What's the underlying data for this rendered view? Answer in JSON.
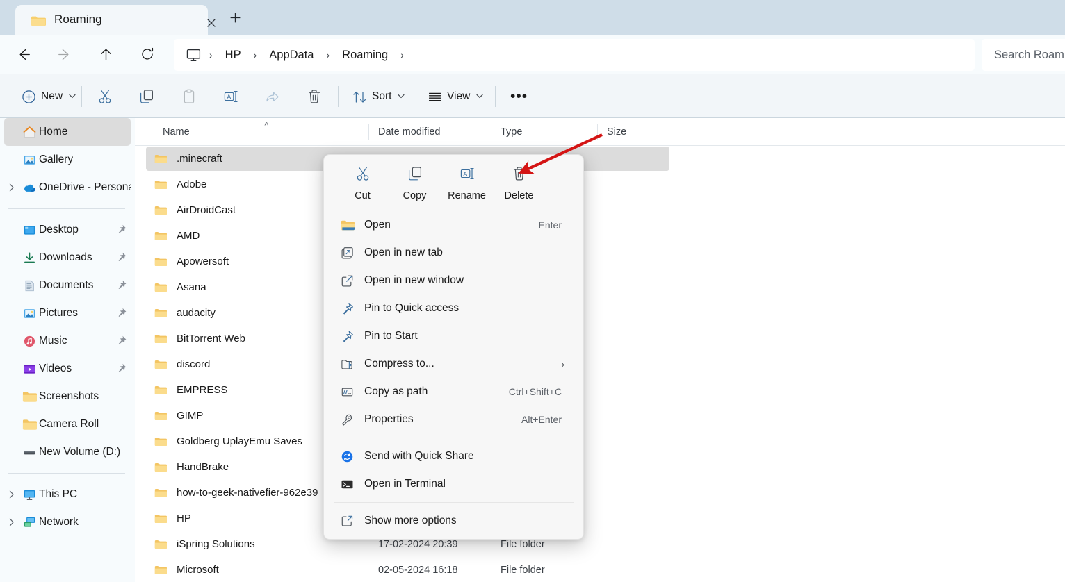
{
  "window": {
    "tab": {
      "title": "Roaming",
      "close_label": "✕",
      "newtab_label": "+"
    }
  },
  "address_bar": {
    "back_tooltip": "Back",
    "forward_tooltip": "Forward",
    "up_tooltip": "Up",
    "refresh_tooltip": "Refresh",
    "breadcrumbs": [
      {
        "label": "HP"
      },
      {
        "label": "AppData"
      },
      {
        "label": "Roaming"
      }
    ],
    "separator": "›",
    "search_placeholder": "Search Roam"
  },
  "command_bar": {
    "new_label": "New",
    "cut_label": "Cut",
    "copy_label": "Copy",
    "paste_label": "Paste",
    "rename_label": "Rename",
    "share_label": "Share",
    "delete_label": "Delete",
    "sort_label": "Sort",
    "view_label": "View",
    "more_label": "•••",
    "chevron": "⌄"
  },
  "sidebar": {
    "items": [
      {
        "label": "Home",
        "icon": "home-icon",
        "selected": true,
        "expandable": false,
        "pinned": false
      },
      {
        "label": "Gallery",
        "icon": "gallery-icon",
        "selected": false,
        "expandable": false,
        "pinned": false
      },
      {
        "label": "OneDrive - Persona",
        "icon": "onedrive-icon",
        "selected": false,
        "expandable": true,
        "pinned": false
      },
      {
        "divider": true
      },
      {
        "label": "Desktop",
        "icon": "desktop-icon",
        "selected": false,
        "expandable": false,
        "pinned": true
      },
      {
        "label": "Downloads",
        "icon": "downloads-icon",
        "selected": false,
        "expandable": false,
        "pinned": true
      },
      {
        "label": "Documents",
        "icon": "documents-icon",
        "selected": false,
        "expandable": false,
        "pinned": true
      },
      {
        "label": "Pictures",
        "icon": "pictures-icon",
        "selected": false,
        "expandable": false,
        "pinned": true
      },
      {
        "label": "Music",
        "icon": "music-icon",
        "selected": false,
        "expandable": false,
        "pinned": true
      },
      {
        "label": "Videos",
        "icon": "videos-icon",
        "selected": false,
        "expandable": false,
        "pinned": true
      },
      {
        "label": "Screenshots",
        "icon": "folder-icon",
        "selected": false,
        "expandable": false,
        "pinned": false
      },
      {
        "label": "Camera Roll",
        "icon": "folder-icon",
        "selected": false,
        "expandable": false,
        "pinned": false
      },
      {
        "label": "New Volume (D:)",
        "icon": "drive-icon",
        "selected": false,
        "expandable": false,
        "pinned": false
      },
      {
        "divider": true
      },
      {
        "label": "This PC",
        "icon": "thispc-icon",
        "selected": false,
        "expandable": true,
        "pinned": false
      },
      {
        "label": "Network",
        "icon": "network-icon",
        "selected": false,
        "expandable": true,
        "pinned": false
      }
    ]
  },
  "file_list": {
    "columns": {
      "name": "Name",
      "date_modified": "Date modified",
      "type": "Type",
      "size": "Size"
    },
    "sort_indicator": "˄",
    "rows": [
      {
        "name": ".minecraft",
        "date": "",
        "type": "",
        "selected": true
      },
      {
        "name": "Adobe",
        "date": "",
        "type": "",
        "selected": false
      },
      {
        "name": "AirDroidCast",
        "date": "",
        "type": "",
        "selected": false
      },
      {
        "name": "AMD",
        "date": "",
        "type": "",
        "selected": false
      },
      {
        "name": "Apowersoft",
        "date": "",
        "type": "",
        "selected": false
      },
      {
        "name": "Asana",
        "date": "",
        "type": "",
        "selected": false
      },
      {
        "name": "audacity",
        "date": "",
        "type": "",
        "selected": false
      },
      {
        "name": "BitTorrent Web",
        "date": "",
        "type": "",
        "selected": false
      },
      {
        "name": "discord",
        "date": "",
        "type": "",
        "selected": false
      },
      {
        "name": "EMPRESS",
        "date": "",
        "type": "",
        "selected": false
      },
      {
        "name": "GIMP",
        "date": "",
        "type": "",
        "selected": false
      },
      {
        "name": "Goldberg UplayEmu Saves",
        "date": "",
        "type": "",
        "selected": false
      },
      {
        "name": "HandBrake",
        "date": "",
        "type": "",
        "selected": false
      },
      {
        "name": "how-to-geek-nativefier-962e39",
        "date": "",
        "type": "",
        "selected": false
      },
      {
        "name": "HP",
        "date": "",
        "type": "",
        "selected": false
      },
      {
        "name": "iSpring Solutions",
        "date": "17-02-2024 20:39",
        "type": "File folder",
        "selected": false
      },
      {
        "name": "Microsoft",
        "date": "02-05-2024 16:18",
        "type": "File folder",
        "selected": false
      }
    ]
  },
  "context_menu": {
    "top_actions": [
      {
        "label": "Cut",
        "icon": "scissors-icon"
      },
      {
        "label": "Copy",
        "icon": "copy-icon"
      },
      {
        "label": "Rename",
        "icon": "rename-icon"
      },
      {
        "label": "Delete",
        "icon": "trash-icon"
      }
    ],
    "items": [
      {
        "label": "Open",
        "icon": "folder-open-icon",
        "accel": "Enter",
        "submenu": false
      },
      {
        "label": "Open in new tab",
        "icon": "new-tab-icon",
        "accel": "",
        "submenu": false
      },
      {
        "label": "Open in new window",
        "icon": "new-window-icon",
        "accel": "",
        "submenu": false
      },
      {
        "label": "Pin to Quick access",
        "icon": "pin-icon",
        "accel": "",
        "submenu": false
      },
      {
        "label": "Pin to Start",
        "icon": "pin-icon",
        "accel": "",
        "submenu": false
      },
      {
        "label": "Compress to...",
        "icon": "compress-icon",
        "accel": "",
        "submenu": true
      },
      {
        "label": "Copy as path",
        "icon": "copy-path-icon",
        "accel": "Ctrl+Shift+C",
        "submenu": false
      },
      {
        "label": "Properties",
        "icon": "properties-icon",
        "accel": "Alt+Enter",
        "submenu": false
      },
      {
        "divider": true
      },
      {
        "label": "Send with Quick Share",
        "icon": "quick-share-icon",
        "accel": "",
        "submenu": false
      },
      {
        "label": "Open in Terminal",
        "icon": "terminal-icon",
        "accel": "",
        "submenu": false
      },
      {
        "divider": true
      },
      {
        "label": "Show more options",
        "icon": "more-options-icon",
        "accel": "",
        "submenu": false
      }
    ],
    "submenu_chevron": "›"
  },
  "annotation": {
    "arrow_color": "#d41414",
    "points_to": "Delete"
  },
  "colors": {
    "titlebar": "#cfdde8",
    "toolbar": "#f2f6f9",
    "sidebar": "#f7fbfd",
    "selection": "#dcdcdc",
    "menu_bg": "#f7f7f7",
    "accent_blue": "#3a6fa8",
    "folder_yellow": "#f6c96b"
  }
}
